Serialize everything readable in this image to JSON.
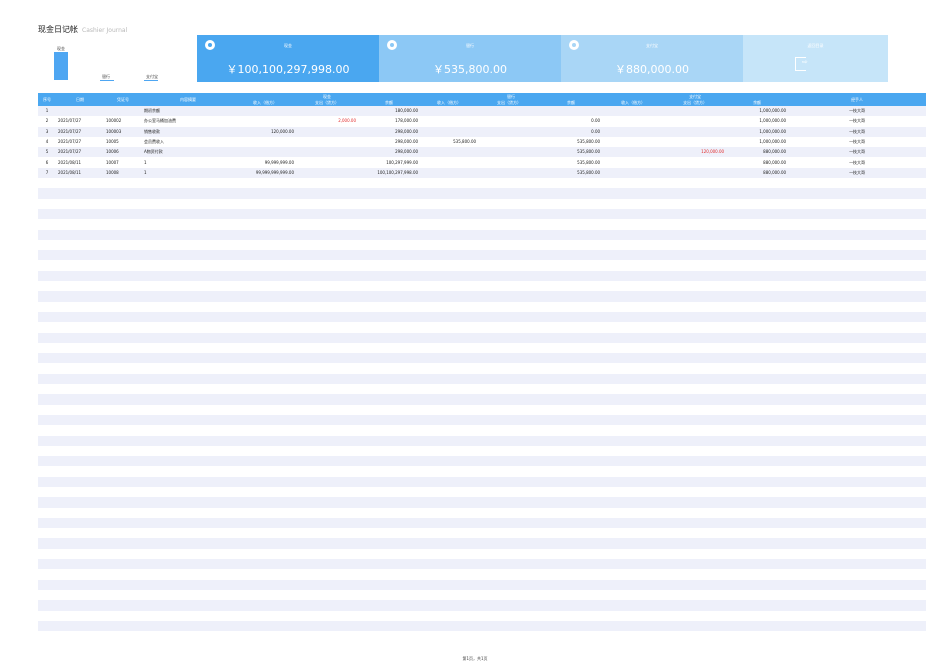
{
  "title": {
    "main": "现金日记帐",
    "sub": "Cashier Journal"
  },
  "mini_chart": {
    "bars": [
      {
        "label": "现金",
        "value": 100100297998.0
      },
      {
        "label": "银行",
        "value": 535800.0
      },
      {
        "label": "支付宝",
        "value": 880000.0
      }
    ],
    "color": "#4ea6f2"
  },
  "cards": {
    "cash": {
      "title": "现金",
      "value": "￥100,100,297,998.00",
      "icon": "money-bag-icon"
    },
    "bank": {
      "title": "银行",
      "value": "￥535,800.00",
      "icon": "bank-icon"
    },
    "alipay": {
      "title": "支付宝",
      "value": "￥880,000.00",
      "icon": "alipay-icon"
    },
    "back": {
      "title": "返回目录",
      "icon": "logout-icon"
    }
  },
  "table": {
    "headers": {
      "seq": "序号",
      "date": "日期",
      "voucher": "凭证号",
      "summary": "内容摘要",
      "cash": "现金",
      "bank": "银行",
      "alipay": "支付宝",
      "handler": "经手人",
      "income": "收入（借方）",
      "expense": "支出（贷方）",
      "balance": "余额"
    },
    "rows": [
      [
        "1",
        "",
        "",
        "期初余额",
        "",
        "",
        "180,000.00",
        "",
        "",
        "",
        "",
        "",
        "1,000,000.00",
        "一枝大哥"
      ],
      [
        "2",
        "2021/07/27",
        "100002",
        "办公室马桶加油费",
        "",
        "2,000.00",
        "178,000.00",
        "",
        "",
        "0.00",
        "",
        "",
        "1,000,000.00",
        "一枝大哥"
      ],
      [
        "3",
        "2021/07/27",
        "100003",
        "销售收款",
        "120,000.00",
        "",
        "298,000.00",
        "",
        "",
        "0.00",
        "",
        "",
        "1,000,000.00",
        "一枝大哥"
      ],
      [
        "4",
        "2021/07/27",
        "10005",
        "会员费收入",
        "",
        "",
        "298,000.00",
        "535,800.00",
        "",
        "535,800.00",
        "",
        "",
        "1,000,000.00",
        "一枝大哥"
      ],
      [
        "5",
        "2021/07/27",
        "10006",
        "A物资付款",
        "",
        "",
        "298,000.00",
        "",
        "",
        "535,800.00",
        "",
        "120,000.00",
        "880,000.00",
        "一枝大哥"
      ],
      [
        "6",
        "2021/08/11",
        "10007",
        "1",
        "99,999,999.00",
        "",
        "100,297,999.00",
        "",
        "",
        "535,800.00",
        "",
        "",
        "880,000.00",
        "一枝大哥"
      ],
      [
        "7",
        "2021/08/11",
        "10008",
        "1",
        "99,999,999,999.00",
        "",
        "100,100,297,998.00",
        "",
        "",
        "535,800.00",
        "",
        "",
        "880,000.00",
        "一枝大哥"
      ]
    ],
    "red_cells": [
      [
        1,
        5
      ],
      [
        4,
        11
      ]
    ]
  },
  "footer": "第1页，共1页"
}
